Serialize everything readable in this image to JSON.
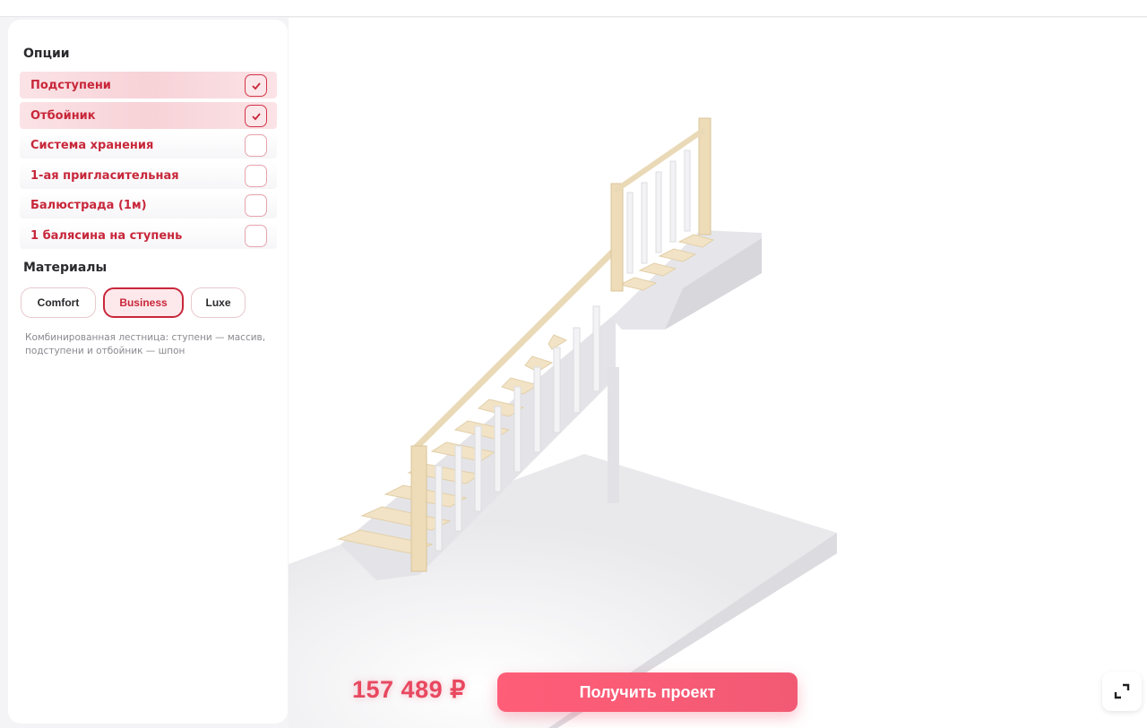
{
  "colors": {
    "accent": "#c8273a",
    "cta": "#f25a74",
    "price": "#e84860"
  },
  "options": {
    "title": "Опции",
    "items": [
      {
        "label": "Подступени",
        "checked": true
      },
      {
        "label": "Отбойник",
        "checked": true
      },
      {
        "label": "Система хранения",
        "checked": false
      },
      {
        "label": "1-ая пригласительная",
        "checked": false
      },
      {
        "label": "Балюстрада (1м)",
        "checked": false
      },
      {
        "label": "1 балясина на ступень",
        "checked": false
      }
    ]
  },
  "materials": {
    "title": "Материалы",
    "buttons": [
      {
        "label": "Comfort"
      },
      {
        "label": "Business"
      },
      {
        "label": "Luxe"
      }
    ],
    "selected": "Business",
    "description": "Комбинированная лестница: ступени — массив, подступени и отбойник — шпон"
  },
  "footer": {
    "price": "157 489 ₽",
    "cta_label": "Получить проект"
  },
  "icons": {
    "check": "check-icon",
    "fullscreen": "fullscreen-icon"
  }
}
